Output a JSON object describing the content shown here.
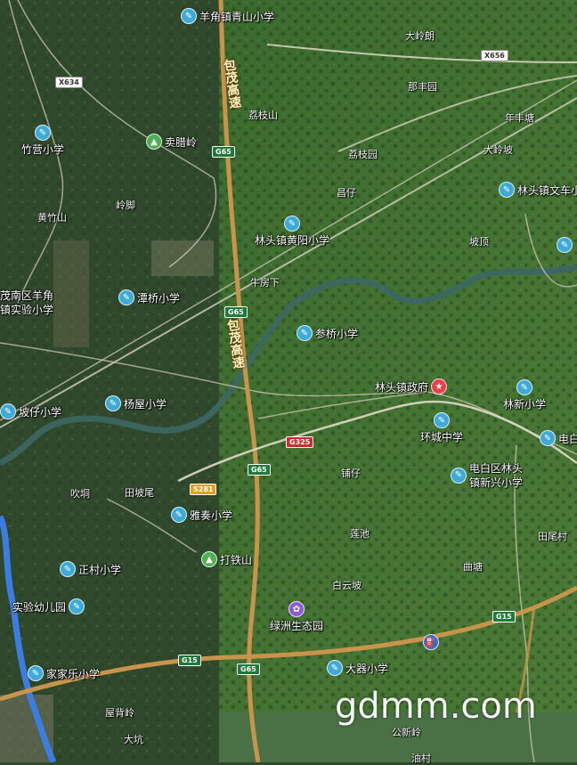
{
  "map": {
    "colors": {
      "satellite_dark": "#2f4a2a",
      "satellite_green": "#3f6b2c",
      "expressway": "#c8934a",
      "river": "#3e6a6a",
      "canal": "#3b7de0"
    },
    "expressway_labels": {
      "north": "包茂高速",
      "south": "包茂高速"
    },
    "shields": {
      "x634": "X634",
      "x656": "X656",
      "g65_a": "G65",
      "g65_b": "G65",
      "g65_c": "G65",
      "g65_d": "G65",
      "g325": "G325",
      "s281": "S281",
      "g15_a": "G15",
      "g15_b": "G15"
    },
    "pois": {
      "yangjiao_qingshan": "羊角镇青山小学",
      "zhuying": "竹营小学",
      "maileling": "卖腊岭",
      "lintou_wenche": "林头镇文车小",
      "lintou_huangyang": "林头镇黄阳小学",
      "tanqiao": "潭桥小学",
      "maonan_yangjiao": "茂南区羊角\n镇实验小学",
      "canqiao": "参桥小学",
      "lintou_gov": "林头镇政府",
      "linxin": "林新小学",
      "pozai": "坡仔小学",
      "yangwu": "杨屋小学",
      "huancheng": "环城中学",
      "dianbai_short": "电白",
      "xinxing": "电白区林头\n镇新兴小学",
      "yazou": "雅奏小学",
      "datieshan": "打铁山",
      "zhengcun": "正村小学",
      "shiyan_kindergarten": "实验幼儿园",
      "lvzhou": "绿洲生态园",
      "jiajiale": "家家乐小学",
      "daqi": "大器小学"
    },
    "places": {
      "dalinglang": "大岭朗",
      "nafeng": "那丰园",
      "nianyuan": "年丰塘",
      "lijiashan": "荔枝山",
      "liyuan": "荔枝园",
      "dadingling": "大岭坡",
      "changzai": "昌仔",
      "dazhushan": "黄竹山",
      "lingjiao": "岭脚",
      "poding": "坡顶",
      "niufangxia": "牛房下",
      "paizai": "铺仔",
      "chuiyong": "吹垌",
      "tianbaiwei": "田坡尾",
      "lianchi": "莲池",
      "quying": "曲塘",
      "tianbaicun": "田尾村",
      "baiyunpo": "白云坡",
      "wulingling": "屋背岭",
      "dakeng": "大坑",
      "gongxinling": "公新岭",
      "youjie": "油村"
    },
    "watermark": "gdmm.com"
  }
}
